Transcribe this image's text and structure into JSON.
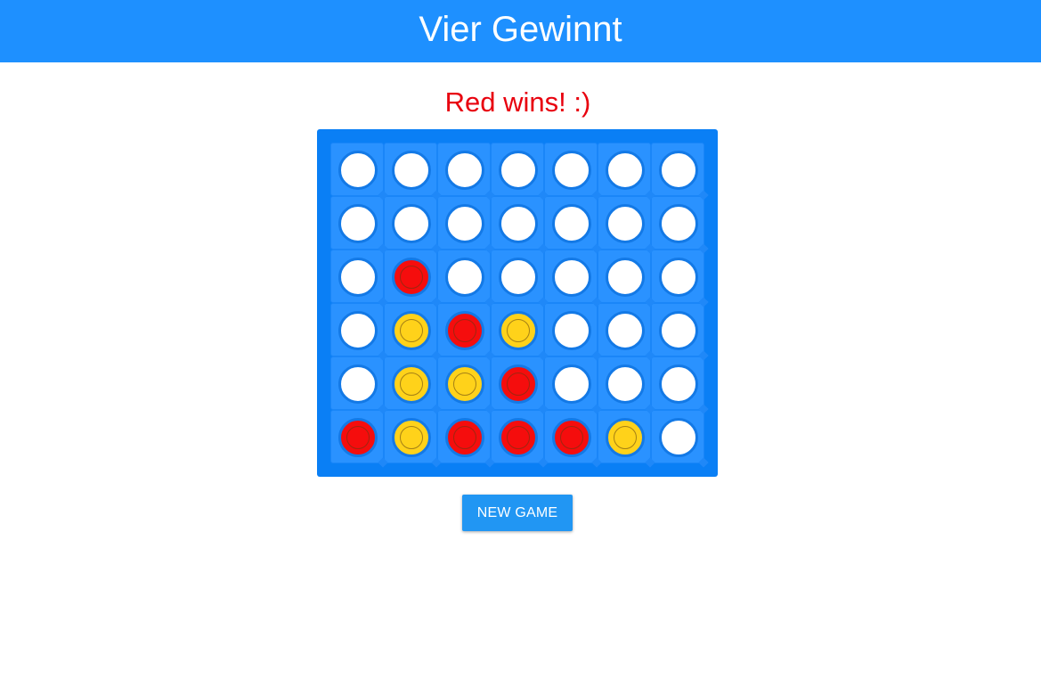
{
  "header": {
    "title": "Vier Gewinnt"
  },
  "status": {
    "text": "Red wins! :)",
    "color": "#e8000e"
  },
  "colors": {
    "header_bg": "#1e90ff",
    "board_bg": "#0a7ff5",
    "cell_bg": "#2a92ff",
    "red": "#f50d0d",
    "yellow": "#ffd21a",
    "empty": "#ffffff",
    "button_bg": "#2196f3"
  },
  "board": {
    "columns": 7,
    "rows": 6,
    "cells": [
      [
        "empty",
        "empty",
        "empty",
        "empty",
        "empty",
        "empty",
        "empty"
      ],
      [
        "empty",
        "empty",
        "empty",
        "empty",
        "empty",
        "empty",
        "empty"
      ],
      [
        "empty",
        "red",
        "empty",
        "empty",
        "empty",
        "empty",
        "empty"
      ],
      [
        "empty",
        "yellow",
        "red",
        "yellow",
        "empty",
        "empty",
        "empty"
      ],
      [
        "empty",
        "yellow",
        "yellow",
        "red",
        "empty",
        "empty",
        "empty"
      ],
      [
        "red",
        "yellow",
        "red",
        "red",
        "red",
        "yellow",
        "empty"
      ]
    ]
  },
  "controls": {
    "new_game_label": "NEW GAME"
  }
}
